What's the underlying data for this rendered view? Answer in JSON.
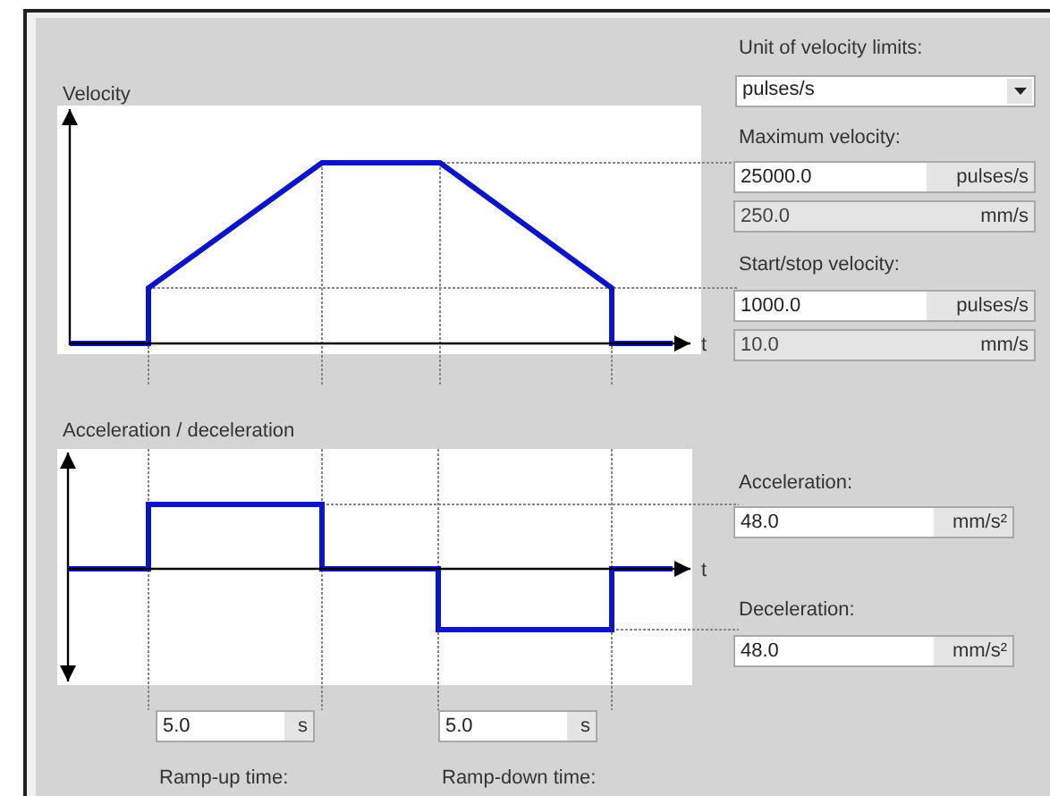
{
  "unit_of_velocity_limits": {
    "label": "Unit of velocity limits:",
    "value": "pulses/s"
  },
  "maximum_velocity": {
    "label": "Maximum velocity:",
    "fields": [
      {
        "value": "25000.0",
        "unit": "pulses/s",
        "disabled": false
      },
      {
        "value": "250.0",
        "unit": "mm/s",
        "disabled": true
      }
    ]
  },
  "start_stop_velocity": {
    "label": "Start/stop velocity:",
    "fields": [
      {
        "value": "1000.0",
        "unit": "pulses/s",
        "disabled": false
      },
      {
        "value": "10.0",
        "unit": "mm/s",
        "disabled": true
      }
    ]
  },
  "velocity_diagram": {
    "title": "Velocity",
    "axis_label": "t"
  },
  "acceleration_diagram": {
    "title": "Acceleration / deceleration",
    "axis_label": "t"
  },
  "acceleration": {
    "label": "Acceleration:",
    "value": "48.0",
    "unit": "mm/s²"
  },
  "deceleration": {
    "label": "Deceleration:",
    "value": "48.0",
    "unit": "mm/s²"
  },
  "ramp_up_time": {
    "label": "Ramp-up time:",
    "value": "5.0",
    "unit": "s"
  },
  "ramp_down_time": {
    "label": "Ramp-down time:",
    "value": "5.0",
    "unit": "s"
  }
}
